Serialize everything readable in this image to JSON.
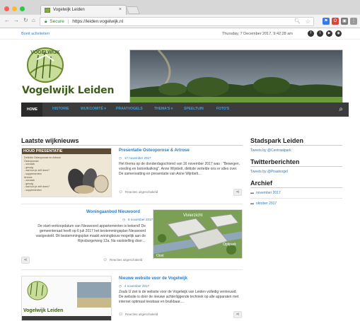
{
  "browser": {
    "tab_title": "Vogelwijk Leiden",
    "tab_close": "×",
    "secure_label": "Secure",
    "url": "https://leiden.vogelwijk.nl"
  },
  "topbar": {
    "left_text": "Boeit activiteiten",
    "datetime": "Thursday, 7 December 2017, 9:42:28 am"
  },
  "site": {
    "title": "Vogelwijk Leiden",
    "logo_text": "VOGELWIJK"
  },
  "nav": {
    "items": [
      "HOME",
      "HISTORIE",
      "WIJKCOMITÉ ▾",
      "PRAATVOGELS",
      "THEMA'S ▾",
      "SPEELTUIN",
      "FOTO'S"
    ]
  },
  "main": {
    "heading": "Laatste wijknieuws",
    "posts": [
      {
        "title": "Presentatie Osteoporose & Artrose",
        "date": "17 november 2017",
        "excerpt": "Het thema op de donderdagochtend van 16 november 2017 was : \"Bewegen, voeding en botontkalking\". Anne Wijnbelt, diëtiste vertelde ons er alles over. De samenvatting en presentatie van Anne Wijnbelt…",
        "meta": "Reacties uitgeschakeld",
        "thumb_title": "HOUD PRESENTATIE",
        "thumb_lines": [
          "Definitie Osteoporose en Artrose",
          "Osteoporose",
          "- oorzaak",
          "- gevolg",
          "- wat kun je zelf doen?",
          "- supplementen",
          "Artrose",
          "- oorzaak",
          "- gevolg",
          "- wat kun je zelf doen?",
          "- supplementen"
        ]
      },
      {
        "title": "Woningaanbod Nieuwoord",
        "date": "8 november 2017",
        "excerpt": "De start-verkoopdatum van Nieuwoord appartementen is bekend! De gemeenteraad heeft op 6 juli 2017 het bestemmingsplan Nieuwoord vastgesteld. Dit bestemmingsplan maakt woningbouw mogelijk aan de Rijnsburgerweg 12a. Na vaststelling door…",
        "meta": "Reacties uitgeschakeld",
        "thumb_label_1": "Vivierzicht",
        "thumb_label_2": "Oost",
        "thumb_label_3": "Optipark"
      },
      {
        "title": "Nieuwe website voor de Vogelwijk",
        "date": "4 november 2017",
        "excerpt": "Zoals U ziet is de website voor de Vogelwijk van Leiden volledig vernieuwd. De website is door de nieuwe achterliggende techniek op alle apparaten met internet optimaal leesbaar en bruikbaar.…",
        "meta": "Reacties uitgeschakeld",
        "thumb_title": "Vogelwijk Leiden"
      }
    ]
  },
  "sidebar": {
    "sections": [
      {
        "heading": "Stadspark Leiden",
        "link": "Tweets by @Centraalpark"
      },
      {
        "heading": "Twitterberichten",
        "link": "Tweets by @Praatvogel"
      },
      {
        "heading": "Archief",
        "items": [
          "november 2017",
          "oktober 2017"
        ]
      }
    ]
  },
  "colors": {
    "accent_blue": "#2e7cc4",
    "brand_green": "#3d5f1a",
    "nav_bg": "#3c3c3c"
  },
  "icons": {
    "share": "share-icon",
    "comment": "comment-icon",
    "clock": "clock-icon",
    "search": "search-icon",
    "folder": "folder-icon"
  }
}
